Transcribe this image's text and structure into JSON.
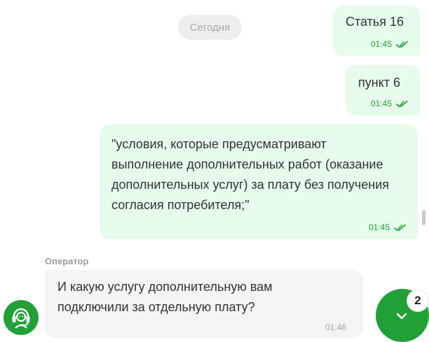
{
  "chat": {
    "date_label": "Сегодня",
    "messages": [
      {
        "text": "Статья 16",
        "time": "01:45"
      },
      {
        "text": "пункт 6",
        "time": "01:45"
      },
      {
        "text": "\"условия, которые предусматривают выполнение дополнительных работ (оказание дополнительных услуг) за плату без получения согласия потребителя;\"",
        "time": "01:45"
      },
      {
        "sender": "Оператор",
        "text": "И какую услугу дополнительную вам подключили за отдельную плату?",
        "time": "01:46"
      }
    ]
  },
  "scroll_button": {
    "badge": "2",
    "icon": "chevron-down-icon"
  },
  "operator_avatar": {
    "icon": "headset-operator-icon"
  },
  "colors": {
    "accent": "#21a038",
    "outgoing_bg": "#e6fbec",
    "incoming_bg": "#f4f4f4",
    "date_pill_bg": "#eeeeee"
  }
}
